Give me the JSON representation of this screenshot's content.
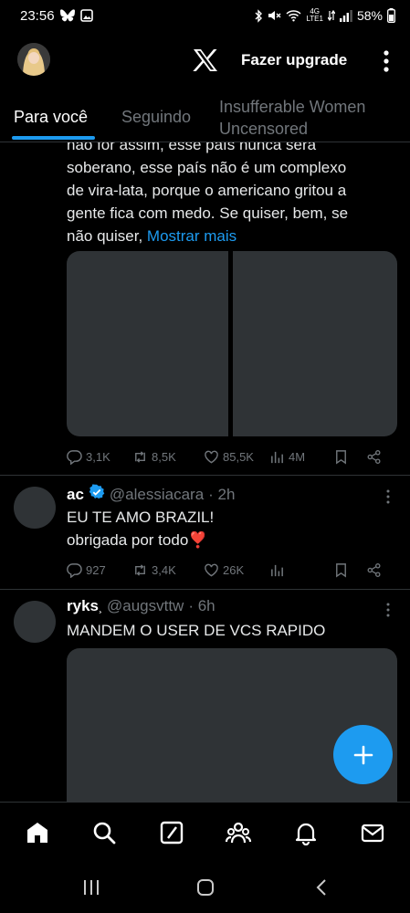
{
  "status_bar": {
    "time": "23:56",
    "network_label": "LTE1",
    "network_gen": "4G",
    "battery": "58%"
  },
  "header": {
    "upgrade_label": "Fazer upgrade"
  },
  "tabs": [
    {
      "label": "Para você",
      "active": true
    },
    {
      "label": "Seguindo",
      "active": false
    },
    {
      "label": "Insufferable Women Uncensored",
      "active": false
    }
  ],
  "tweets": [
    {
      "text_lines": [
        "não for assim, esse país nunca será",
        "soberano, esse país não é um complexo",
        "de vira-lata, porque o americano gritou a",
        "gente fica com medo. Se quiser, bem, se",
        "não quiser, "
      ],
      "show_more": "Mostrar mais",
      "stats": {
        "replies": "3,1K",
        "retweets": "8,5K",
        "likes": "85,5K",
        "views": "4M"
      }
    },
    {
      "name": "ac",
      "verified": true,
      "handle": "@alessiacara",
      "time": "· 2h",
      "text_line1": "EU TE AMO BRAZIL!",
      "text_line2": "obrigada por todo",
      "emoji": "❣️",
      "stats": {
        "replies": "927",
        "retweets": "3,4K",
        "likes": "26K"
      }
    },
    {
      "name": "ryks",
      "name_suffix": "¸",
      "handle": "@augsvttw",
      "time": "· 6h",
      "text_line1": "MANDEM O USER DE VCS RAPIDO"
    }
  ],
  "colors": {
    "accent": "#1d9bf0",
    "background": "#000000",
    "muted": "#71767b",
    "border": "#2f3336"
  },
  "icons": {
    "nav": [
      "home-icon",
      "search-icon",
      "grok-icon",
      "communities-icon",
      "notifications-icon",
      "messages-icon"
    ],
    "fab": "plus-icon"
  }
}
